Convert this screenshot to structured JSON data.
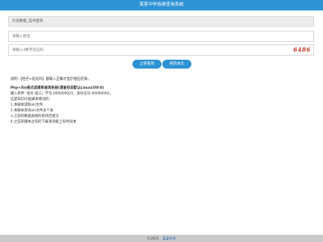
{
  "header": {
    "title": "某某中学成绩查询系统"
  },
  "form": {
    "select_label": "尽览数据_证书查询",
    "name_placeholder": "请输入姓名",
    "code_placeholder": "请输入4数字验证码",
    "captcha_text": "6486",
    "query_button": "立即查询",
    "reset_button": "刷新本页"
  },
  "info": {
    "line1": "说明:【姓名+验证码】都输入正确才显示相应结果。",
    "line2": "Php+Xls格式成绩单查询系统(请查找非默认Linux(Utf-8)",
    "line3": "输入条件: 姓名:张三；学号:000000001；身份证号:00000002。",
    "line4": "这是知识ID类脚本情况的:",
    "line5": "1.本脚本读取xls文件",
    "line6": "2.本脚本查询xls文件多个表",
    "line7": "3.之前的数据表格的修改后提交",
    "line8": "4.之前的脚本过有的下载查询版上有时间本"
  },
  "footer": {
    "copyright": "©2021",
    "link_text": "某某中学"
  }
}
